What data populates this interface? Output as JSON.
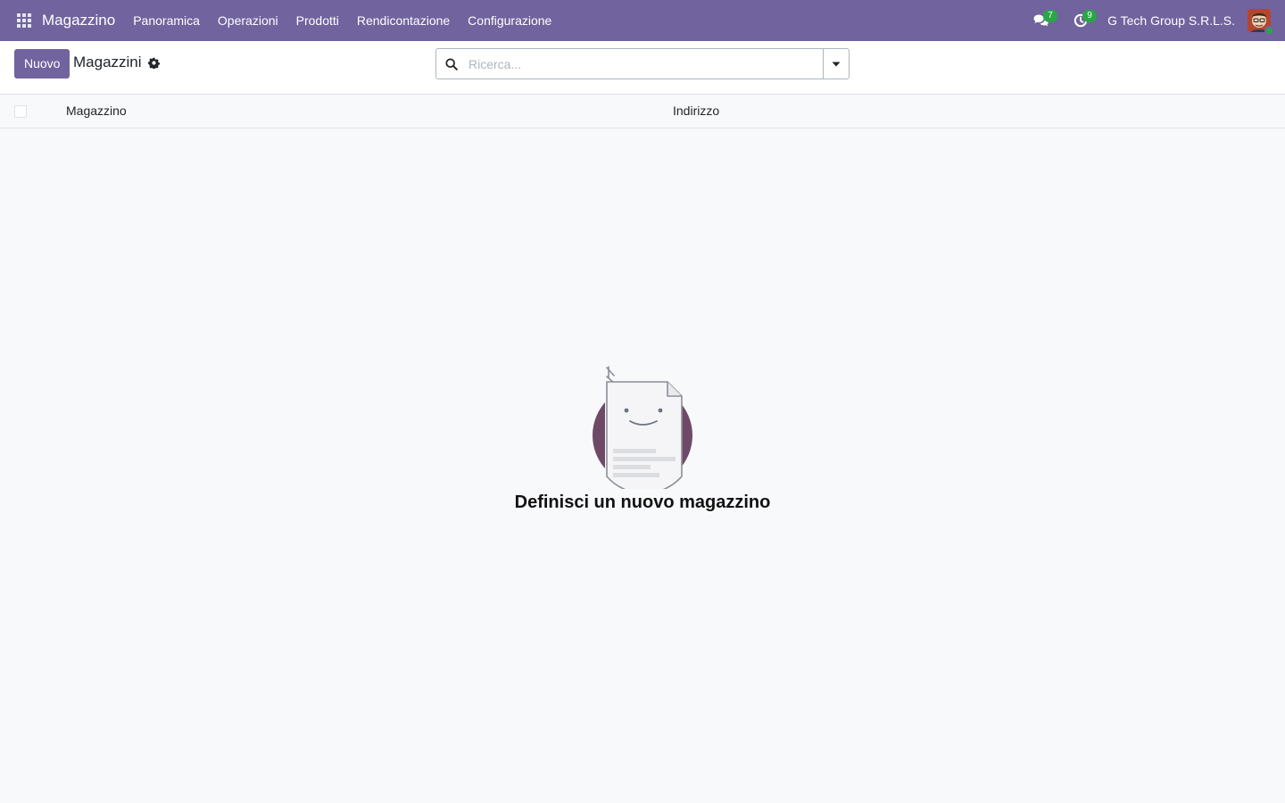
{
  "navbar": {
    "app_name": "Magazzino",
    "menu": [
      {
        "label": "Panoramica"
      },
      {
        "label": "Operazioni"
      },
      {
        "label": "Prodotti"
      },
      {
        "label": "Rendicontazione"
      },
      {
        "label": "Configurazione"
      }
    ],
    "messages_count": "7",
    "activities_count": "9",
    "company": "G Tech Group S.R.L.S.",
    "accent_color": "#71639e",
    "badge_color": "#28a745"
  },
  "control_panel": {
    "new_button_label": "Nuovo",
    "breadcrumb": "Magazzini",
    "search_placeholder": "Ricerca..."
  },
  "list": {
    "columns": [
      {
        "label": "Magazzino"
      },
      {
        "label": "Indirizzo"
      }
    ]
  },
  "empty_state": {
    "title": "Definisci un nuovo magazzino"
  },
  "icons": {
    "apps": "apps-grid-icon",
    "messages": "chat-icon",
    "activities": "clock-icon",
    "settings": "gear-icon",
    "search": "search-icon",
    "toggle": "caret-down-icon"
  }
}
